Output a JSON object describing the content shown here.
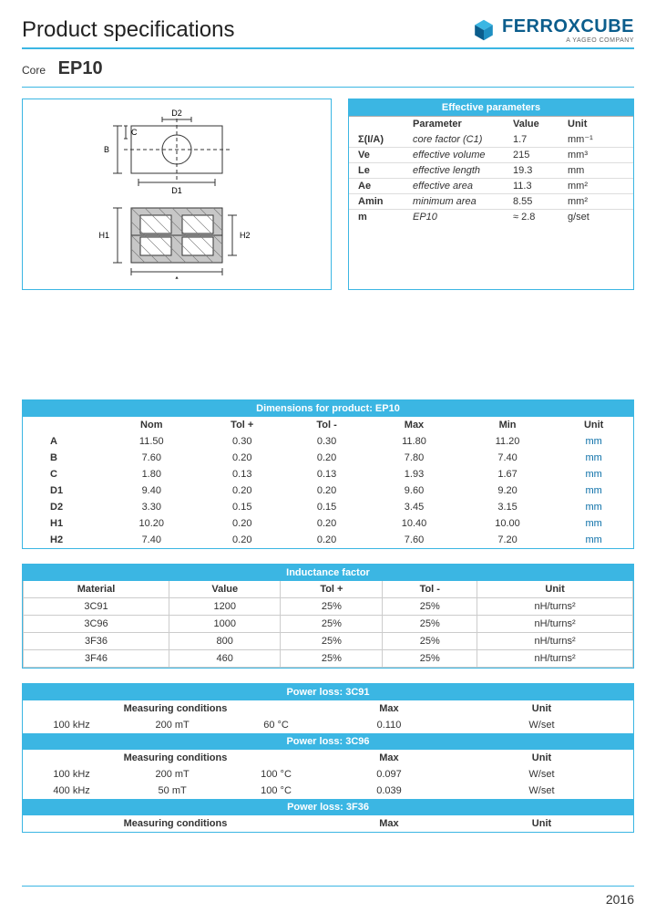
{
  "header": {
    "title": "Product specifications",
    "brand": "FERROXCUBE",
    "brand_sub": "A YAGEO COMPANY"
  },
  "subheader": {
    "core_label": "Core",
    "model": "EP10"
  },
  "diagram_labels": {
    "B": "B",
    "C": "C",
    "D1": "D1",
    "D2": "D2",
    "H1": "H1",
    "H2": "H2",
    "A": "A"
  },
  "params": {
    "title": "Effective parameters",
    "headers": [
      "",
      "Parameter",
      "Value",
      "Unit"
    ],
    "rows": [
      {
        "sym": "Σ(I/A)",
        "name": "core factor (C1)",
        "val": "1.7",
        "unit": "mm⁻¹"
      },
      {
        "sym": "Ve",
        "name": "effective volume",
        "val": "215",
        "unit": "mm³"
      },
      {
        "sym": "Le",
        "name": "effective length",
        "val": "19.3",
        "unit": "mm"
      },
      {
        "sym": "Ae",
        "name": "effective area",
        "val": "11.3",
        "unit": "mm²"
      },
      {
        "sym": "Amin",
        "name": "minimum area",
        "val": "8.55",
        "unit": "mm²"
      },
      {
        "sym": "m",
        "name": "EP10",
        "val": "≈ 2.8",
        "unit": "g/set"
      }
    ]
  },
  "dims": {
    "title": "Dimensions for product: EP10",
    "headers": [
      "",
      "Nom",
      "Tol +",
      "Tol -",
      "Max",
      "Min",
      "Unit"
    ],
    "rows": [
      {
        "n": "A",
        "nom": "11.50",
        "tp": "0.30",
        "tm": "0.30",
        "max": "11.80",
        "min": "11.20",
        "u": "mm"
      },
      {
        "n": "B",
        "nom": "7.60",
        "tp": "0.20",
        "tm": "0.20",
        "max": "7.80",
        "min": "7.40",
        "u": "mm"
      },
      {
        "n": "C",
        "nom": "1.80",
        "tp": "0.13",
        "tm": "0.13",
        "max": "1.93",
        "min": "1.67",
        "u": "mm"
      },
      {
        "n": "D1",
        "nom": "9.40",
        "tp": "0.20",
        "tm": "0.20",
        "max": "9.60",
        "min": "9.20",
        "u": "mm"
      },
      {
        "n": "D2",
        "nom": "3.30",
        "tp": "0.15",
        "tm": "0.15",
        "max": "3.45",
        "min": "3.15",
        "u": "mm"
      },
      {
        "n": "H1",
        "nom": "10.20",
        "tp": "0.20",
        "tm": "0.20",
        "max": "10.40",
        "min": "10.00",
        "u": "mm"
      },
      {
        "n": "H2",
        "nom": "7.40",
        "tp": "0.20",
        "tm": "0.20",
        "max": "7.60",
        "min": "7.20",
        "u": "mm"
      }
    ]
  },
  "inductance": {
    "title": "Inductance factor",
    "headers": [
      "Material",
      "Value",
      "Tol +",
      "Tol -",
      "Unit"
    ],
    "rows": [
      {
        "m": "3C91",
        "v": "1200",
        "tp": "25%",
        "tm": "25%",
        "u": "nH/turns²"
      },
      {
        "m": "3C96",
        "v": "1000",
        "tp": "25%",
        "tm": "25%",
        "u": "nH/turns²"
      },
      {
        "m": "3F36",
        "v": "800",
        "tp": "25%",
        "tm": "25%",
        "u": "nH/turns²"
      },
      {
        "m": "3F46",
        "v": "460",
        "tp": "25%",
        "tm": "25%",
        "u": "nH/turns²"
      }
    ]
  },
  "powerloss": {
    "headers_cond": "Measuring conditions",
    "headers_max": "Max",
    "headers_unit": "Unit",
    "groups": [
      {
        "title": "Power loss:  3C91",
        "rows": [
          {
            "c1": "100 kHz",
            "c2": "200 mT",
            "c3": "60 °C",
            "max": "0.110",
            "u": "W/set"
          }
        ]
      },
      {
        "title": "Power loss:  3C96",
        "rows": [
          {
            "c1": "100 kHz",
            "c2": "200 mT",
            "c3": "100 °C",
            "max": "0.097",
            "u": "W/set"
          },
          {
            "c1": "400 kHz",
            "c2": "50 mT",
            "c3": "100 °C",
            "max": "0.039",
            "u": "W/set"
          }
        ]
      },
      {
        "title": "Power loss:  3F36",
        "rows": []
      }
    ]
  },
  "footer": {
    "year": "2016"
  }
}
